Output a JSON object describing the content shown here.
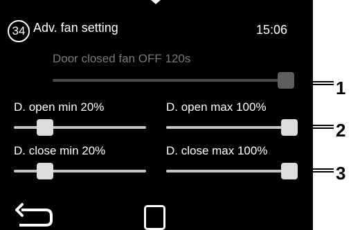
{
  "header": {
    "page_number": "34",
    "title": "Adv. fan setting",
    "time": "15:06"
  },
  "door_closed_fan_off": {
    "label": "Door closed fan OFF  120s",
    "value_fraction": 1.0,
    "enabled": false
  },
  "sliders": {
    "open_min": {
      "label": "D. open min 20%",
      "value_percent": 20
    },
    "open_max": {
      "label": "D. open max 100%",
      "value_percent": 100
    },
    "close_min": {
      "label": "D. close min 20%",
      "value_percent": 20
    },
    "close_max": {
      "label": "D. close max 100%",
      "value_percent": 100
    }
  },
  "nav": {
    "back_icon": "back-arrow-icon",
    "home_icon": "home-square-icon"
  },
  "callouts": [
    "1",
    "2",
    "3"
  ],
  "colors": {
    "screen_background": "#000000",
    "text": "#ffffff",
    "disabled_text": "#7a7a7a",
    "slider_thumb": "#dcdcdc",
    "slider_track": "#c4c4c4"
  }
}
